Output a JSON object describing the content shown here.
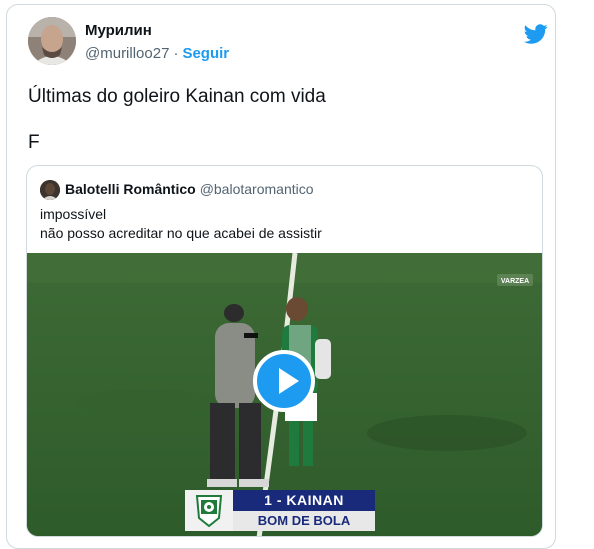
{
  "tweet": {
    "author_name": "Мурилин",
    "author_handle": "@murilloo27",
    "separator": "·",
    "follow_label": "Seguir",
    "text_line1": "Últimas do goleiro Kainan com vida",
    "text_line2": "F"
  },
  "quoted": {
    "author_name": "Balotelli Romântico",
    "author_handle": "@balotaromantico",
    "text_line1": "impossível",
    "text_line2": "não posso acreditar no que acabei de assistir",
    "video": {
      "lower_third_name": "1 - KAINAN",
      "lower_third_sub": "BOM DE BOLA",
      "watermark": "VARZEA"
    }
  },
  "colors": {
    "accent": "#1d9bf0",
    "border": "#cfd9de",
    "muted": "#536471"
  },
  "icons": {
    "brand": "twitter-bird-icon",
    "play": "play-icon"
  }
}
